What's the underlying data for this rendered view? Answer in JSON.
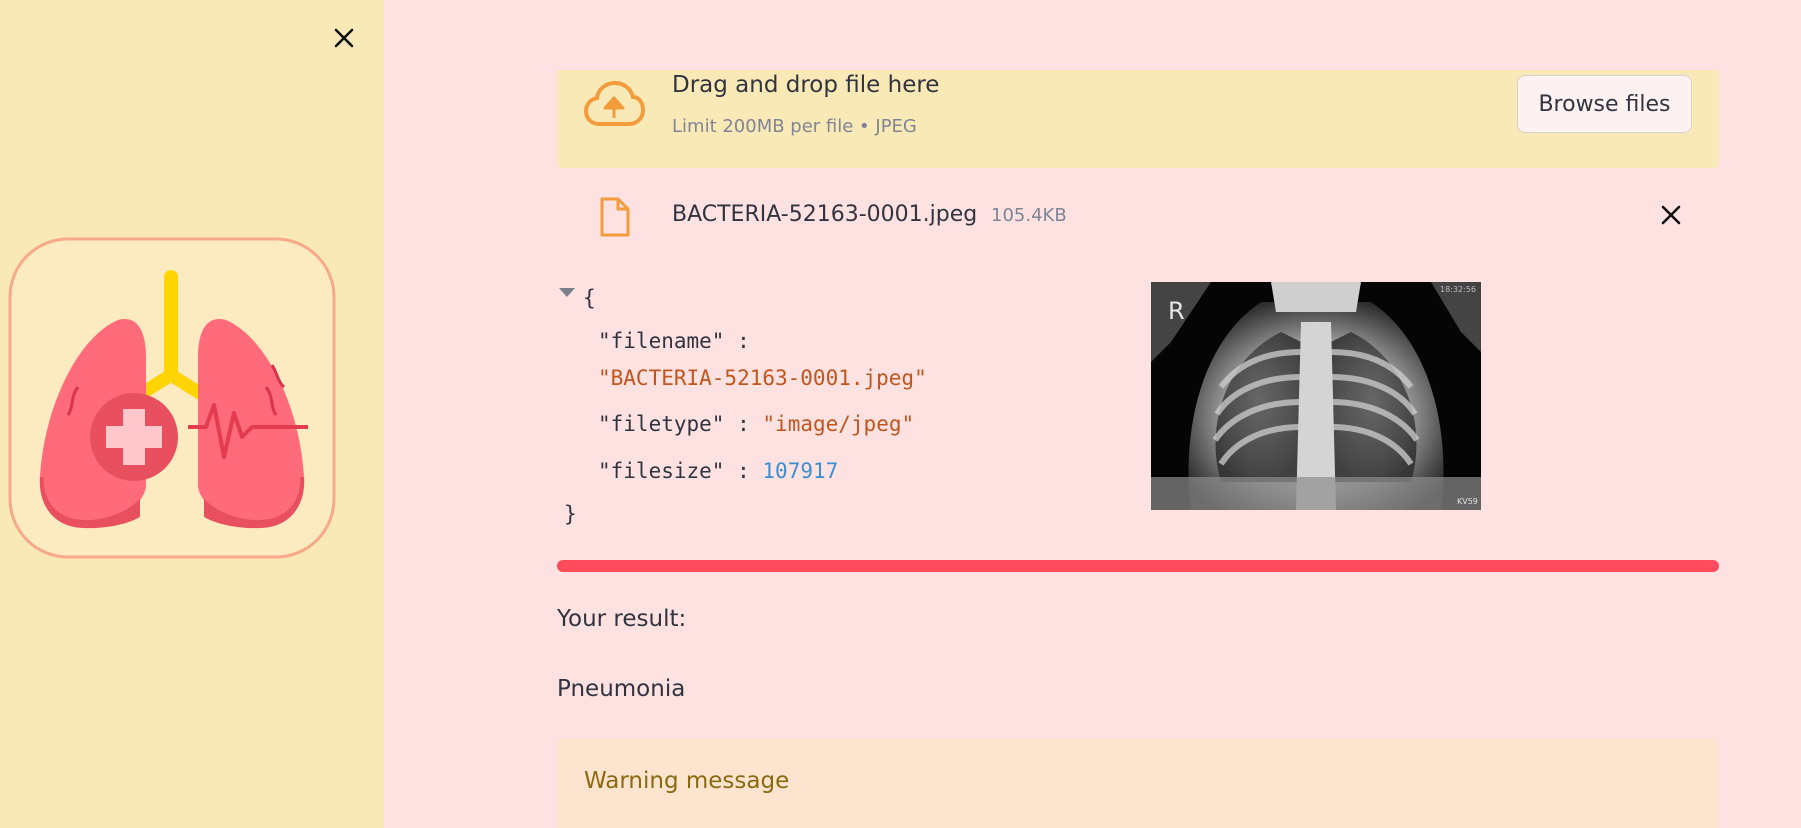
{
  "colors": {
    "sidebar_bg": "#f9e9b7",
    "main_bg": "#fee2e2",
    "progress": "#ff4b5c",
    "accent_orange": "#f49b3c",
    "warning_bg": "#fde4cf",
    "warning_text": "#8a6a10"
  },
  "sidebar": {
    "close_icon": "close-icon",
    "logo_icon": "lungs-medical-icon"
  },
  "uploader": {
    "icon": "cloud-upload-icon",
    "title": "Drag and drop file here",
    "subtitle": "Limit 200MB per file • JPEG",
    "browse_label": "Browse files"
  },
  "file": {
    "icon": "file-icon",
    "name": "BACTERIA-52163-0001.jpeg",
    "size": "105.4KB",
    "remove_icon": "close-icon"
  },
  "json_view": {
    "open_brace": "{",
    "close_brace": "}",
    "filename_key": "\"filename\"",
    "filename_value": "\"BACTERIA-52163-0001.jpeg\"",
    "filetype_key": "\"filetype\"",
    "filetype_value": "\"image/jpeg\"",
    "filesize_key": "\"filesize\"",
    "filesize_value": "107917",
    "colon": ":"
  },
  "image": {
    "marker": "R",
    "corner_tl": "18:32:56",
    "corner_br": "KV59"
  },
  "progress": {
    "value": 1.0
  },
  "result": {
    "label": "Your result:",
    "value": "Pneumonia"
  },
  "warning": {
    "text": "Warning message"
  }
}
